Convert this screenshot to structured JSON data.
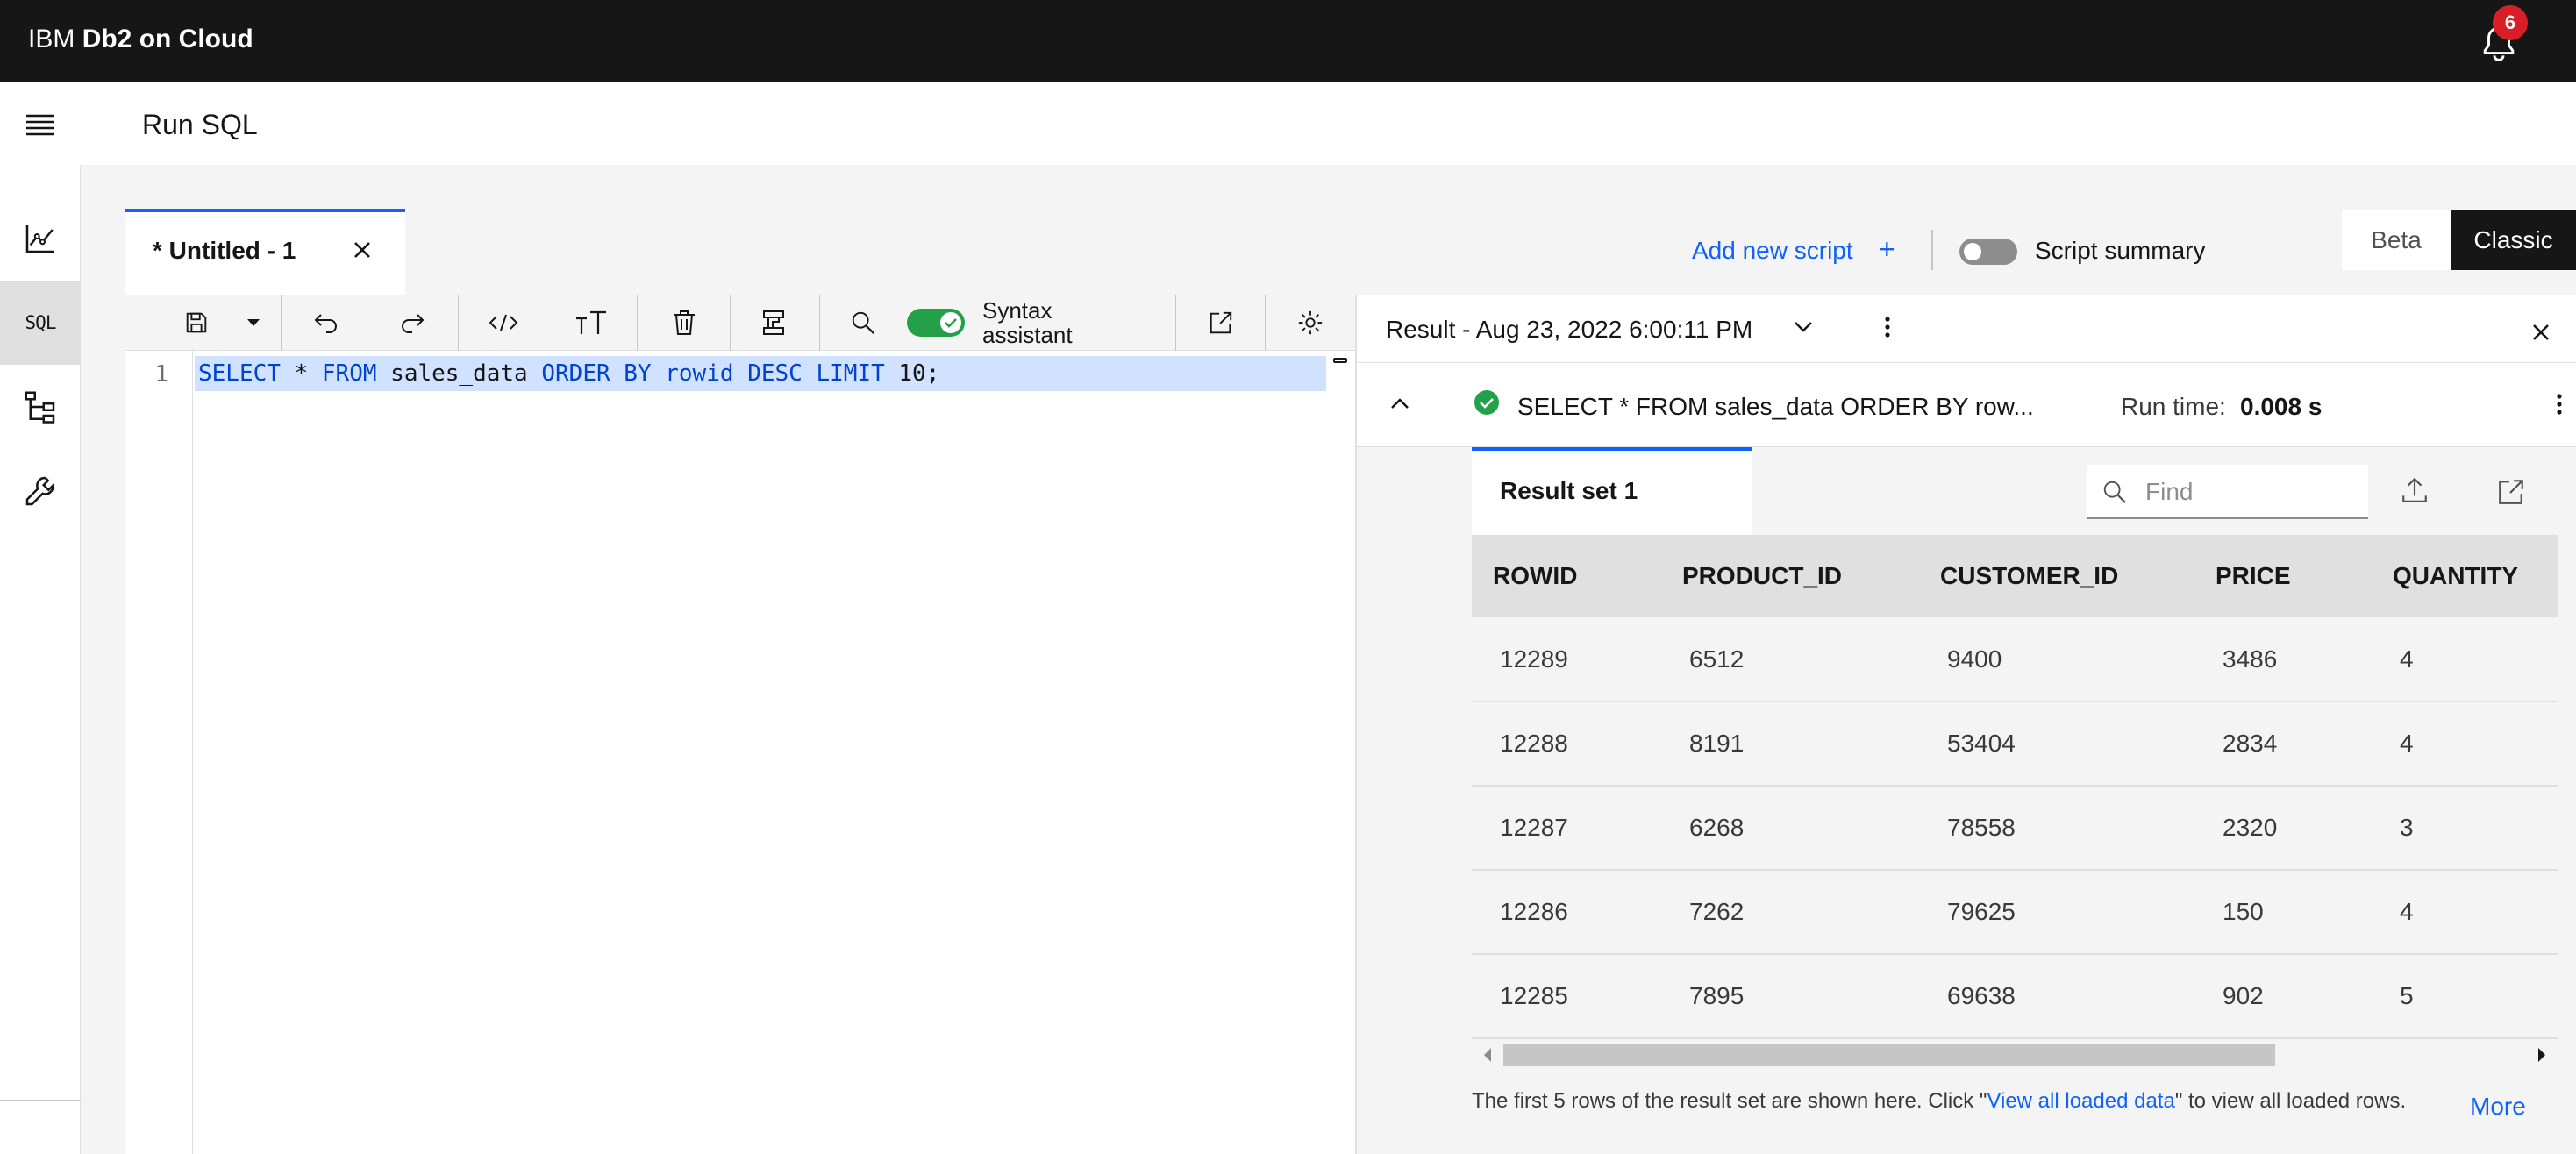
{
  "topbar": {
    "brand_prefix": "IBM",
    "brand_name": "Db2 on Cloud",
    "notification_count": "6"
  },
  "header": {
    "page_title": "Run SQL"
  },
  "rail": {
    "items": [
      "monitor-icon",
      "sql-icon",
      "schema-icon",
      "wrench-icon"
    ],
    "sql_label": "SQL"
  },
  "script_tabs": {
    "active_label": "* Untitled - 1"
  },
  "actions": {
    "add_script": "Add new script",
    "add_plus": "+",
    "script_summary": "Script summary",
    "beta": "Beta",
    "classic": "Classic"
  },
  "editor": {
    "syntax_label": "Syntax assistant",
    "line_number": "1",
    "code": {
      "kw1": "SELECT",
      "sym1": " * ",
      "kw2": "FROM",
      "tbl": " sales_data ",
      "kw3": "ORDER BY",
      "sp1": " ",
      "col": "rowid",
      "sp2": " ",
      "kw4": "DESC",
      "sp3": " ",
      "kw5": "LIMIT",
      "tail": " 10;"
    }
  },
  "result": {
    "title": "Result - Aug 23, 2022 6:00:11 PM",
    "query": "SELECT * FROM sales_data ORDER BY row...",
    "runtime_label": "Run time:",
    "runtime_value": "0.008 s",
    "tab_label": "Result set 1",
    "find_placeholder": "Find",
    "columns": [
      "ROWID",
      "PRODUCT_ID",
      "CUSTOMER_ID",
      "PRICE",
      "QUANTITY"
    ],
    "rows": [
      [
        "12289",
        "6512",
        "9400",
        "3486",
        "4"
      ],
      [
        "12288",
        "8191",
        "53404",
        "2834",
        "4"
      ],
      [
        "12287",
        "6268",
        "78558",
        "2320",
        "3"
      ],
      [
        "12286",
        "7262",
        "79625",
        "150",
        "4"
      ],
      [
        "12285",
        "7895",
        "69638",
        "902",
        "5"
      ]
    ],
    "footnote_a": "The first 5 rows of the result set are shown here. Click \"",
    "footnote_link": "View all loaded data",
    "footnote_b": "\" to view all loaded rows.",
    "more": "More"
  },
  "colors": {
    "accent": "#0f62fe",
    "success": "#24a148",
    "badge": "#da1e28",
    "topbar": "#161616"
  }
}
